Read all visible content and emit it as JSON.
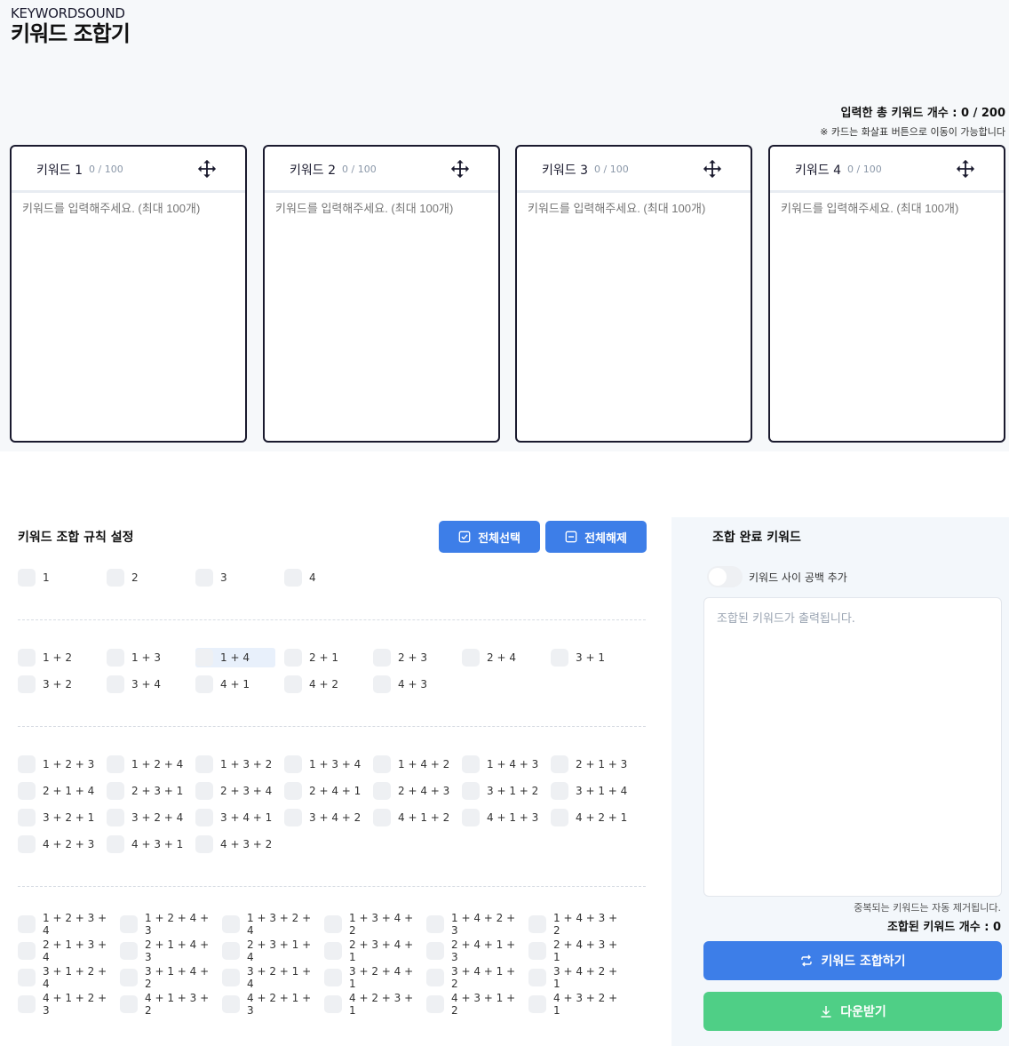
{
  "brand": {
    "small": "KEYWORDSOUND",
    "title": "키워드 조합기"
  },
  "total_count": "입력한 총 키워드 개수 : 0 / 200",
  "move_hint": "※ 카드는 화살표 버튼으로 이동이 가능합니다",
  "cards": [
    {
      "title": "키워드 1",
      "count": "0 / 100",
      "placeholder": "키워드를 입력해주세요. (최대 100개)"
    },
    {
      "title": "키워드 2",
      "count": "0 / 100",
      "placeholder": "키워드를 입력해주세요. (최대 100개)"
    },
    {
      "title": "키워드 3",
      "count": "0 / 100",
      "placeholder": "키워드를 입력해주세요. (최대 100개)"
    },
    {
      "title": "키워드 4",
      "count": "0 / 100",
      "placeholder": "키워드를 입력해주세요. (최대 100개)"
    }
  ],
  "rules": {
    "title": "키워드 조합 규칙 설정",
    "select_all": "전체선택",
    "deselect_all": "전체해제",
    "singles": [
      "1",
      "2",
      "3",
      "4"
    ],
    "pairs": [
      "1 + 2",
      "1 + 3",
      "1 + 4",
      "2 + 1",
      "2 + 3",
      "2 + 4",
      "3 + 1",
      "3 + 2",
      "3 + 4",
      "4 + 1",
      "4 + 2",
      "4 + 3"
    ],
    "triples": [
      "1 + 2 + 3",
      "1 + 2 + 4",
      "1 + 3 + 2",
      "1 + 3 + 4",
      "1 + 4 + 2",
      "1 + 4 + 3",
      "2 + 1 + 3",
      "2 + 1 + 4",
      "2 + 3 + 1",
      "2 + 3 + 4",
      "2 + 4 + 1",
      "2 + 4 + 3",
      "3 + 1 + 2",
      "3 + 1 + 4",
      "3 + 2 + 1",
      "3 + 2 + 4",
      "3 + 4 + 1",
      "3 + 4 + 2",
      "4 + 1 + 2",
      "4 + 1 + 3",
      "4 + 2 + 1",
      "4 + 2 + 3",
      "4 + 3 + 1",
      "4 + 3 + 2"
    ],
    "quads": [
      "1 + 2 + 3 + 4",
      "1 + 2 + 4 + 3",
      "1 + 3 + 2 + 4",
      "1 + 3 + 4 + 2",
      "1 + 4 + 2 + 3",
      "1 + 4 + 3 + 2",
      "2 + 1 + 3 + 4",
      "2 + 1 + 4 + 3",
      "2 + 3 + 1 + 4",
      "2 + 3 + 4 + 1",
      "2 + 4 + 1 + 3",
      "2 + 4 + 3 + 1",
      "3 + 1 + 2 + 4",
      "3 + 1 + 4 + 2",
      "3 + 2 + 1 + 4",
      "3 + 2 + 4 + 1",
      "3 + 4 + 1 + 2",
      "3 + 4 + 2 + 1",
      "4 + 1 + 2 + 3",
      "4 + 1 + 3 + 2",
      "4 + 2 + 1 + 3",
      "4 + 2 + 3 + 1",
      "4 + 3 + 1 + 2",
      "4 + 3 + 2 + 1"
    ]
  },
  "result": {
    "title": "조합 완료 키워드",
    "space_toggle_label": "키워드 사이 공백 추가",
    "placeholder": "조합된 키워드가 출력됩니다.",
    "dup_note": "중복되는 키워드는 자동 제거됩니다.",
    "combined_count": "조합된 키워드 개수 : 0",
    "combine_button": "키워드 조합하기",
    "download_button": "다운받기"
  },
  "colors": {
    "primary": "#3d7ee8",
    "download": "#4fcf86",
    "top_bg": "#f6f8fa",
    "panel_bg": "#f3f7fb"
  },
  "icons": [
    "move-icon",
    "check-square-icon",
    "minus-square-icon",
    "repeat-icon",
    "download-icon"
  ]
}
